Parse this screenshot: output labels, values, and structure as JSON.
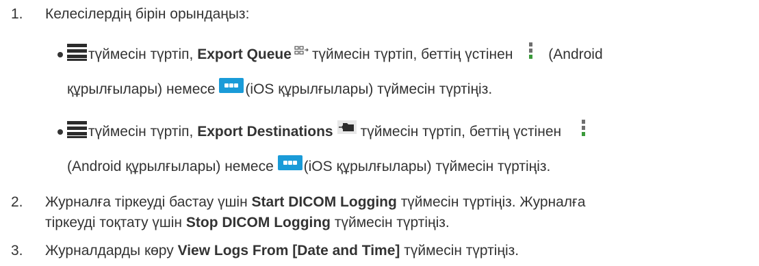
{
  "steps": [
    {
      "number": "1.",
      "text": "Келесілердің бірін орындаңыз:",
      "bullets": [
        {
          "line1": {
            "part1": "түймесін түртіп,",
            "bold": "Export Queue",
            "part2": "түймесін түртіп, беттің үстінен",
            "part3": "(Android"
          },
          "line2": {
            "part1": "құрылғылары) немесе",
            "part2": "(iOS құрылғылары) түймесін түртіңіз."
          }
        },
        {
          "line1": {
            "part1": "түймесін түртіп,",
            "bold": "Export Destinations",
            "part2": "түймесін түртіп, беттің үстінен"
          },
          "line2": {
            "part1": "(Android құрылғылары) немесе",
            "part2": "(iOS құрылғылары) түймесін түртіңіз."
          }
        }
      ]
    },
    {
      "number": "2.",
      "line1": {
        "part1": "Журналға тіркеуді бастау үшін",
        "bold": "Start DICOM Logging",
        "part2": "түймесін түртіңіз. Журналға"
      },
      "line2": {
        "part1": "тіркеуді тоқтату үшін",
        "bold": "Stop DICOM Logging",
        "part2": "түймесін түртіңіз."
      }
    },
    {
      "number": "3.",
      "line1": {
        "part1": "Журналдарды көру",
        "bold": "View Logs From [Date and Time]",
        "part2": "түймесін түртіңіз."
      }
    }
  ],
  "icons": {
    "menu": "menu-icon",
    "export_queue": "export-queue-icon",
    "android_more": "vertical-dots-icon",
    "ios_more": "ios-more-icon",
    "export_destinations": "export-destinations-icon",
    "ios_more_color": "#1a9bd8",
    "android_dot_accent": "#3a9a3a"
  }
}
